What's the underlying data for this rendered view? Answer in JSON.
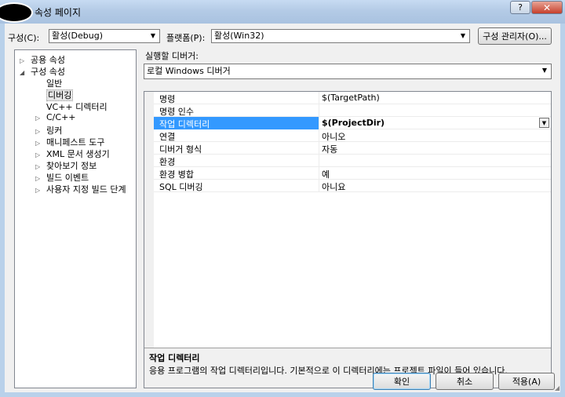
{
  "window": {
    "title": "속성 페이지",
    "help_label": "?",
    "close_label": "✕"
  },
  "config": {
    "label": "구성(C):",
    "value": "활성(Debug)"
  },
  "platform": {
    "label": "플랫폼(P):",
    "value": "활성(Win32)"
  },
  "config_manager_button": "구성 관리자(O)...",
  "tree": {
    "items": [
      {
        "label": "공용 속성",
        "expander": "▷"
      },
      {
        "label": "구성 속성",
        "expander": "◢"
      },
      {
        "label": "일반",
        "expander": ""
      },
      {
        "label": "디버깅",
        "expander": ""
      },
      {
        "label": "VC++ 디렉터리",
        "expander": ""
      },
      {
        "label": "C/C++",
        "expander": "▷"
      },
      {
        "label": "링커",
        "expander": "▷"
      },
      {
        "label": "매니페스트 도구",
        "expander": "▷"
      },
      {
        "label": "XML 문서 생성기",
        "expander": "▷"
      },
      {
        "label": "찾아보기 정보",
        "expander": "▷"
      },
      {
        "label": "빌드 이벤트",
        "expander": "▷"
      },
      {
        "label": "사용자 지정 빌드 단계",
        "expander": "▷"
      }
    ]
  },
  "debugger": {
    "label": "실행할 디버거:",
    "value": "로컬 Windows 디버거"
  },
  "properties": [
    {
      "name": "명령",
      "value": "$(TargetPath)"
    },
    {
      "name": "명령 인수",
      "value": ""
    },
    {
      "name": "작업 디렉터리",
      "value": "$(ProjectDir)"
    },
    {
      "name": "연결",
      "value": "아니오"
    },
    {
      "name": "디버거 형식",
      "value": "자동"
    },
    {
      "name": "환경",
      "value": ""
    },
    {
      "name": "환경 병합",
      "value": "예"
    },
    {
      "name": "SQL 디버깅",
      "value": "아니요"
    }
  ],
  "description": {
    "title": "작업 디렉터리",
    "text": "응용 프로그램의 작업 디렉터리입니다. 기본적으로 이 디렉터리에는 프로젝트 파일이 들어 있습니다."
  },
  "buttons": {
    "ok": "확인",
    "cancel": "취소",
    "apply": "적용(A)"
  }
}
